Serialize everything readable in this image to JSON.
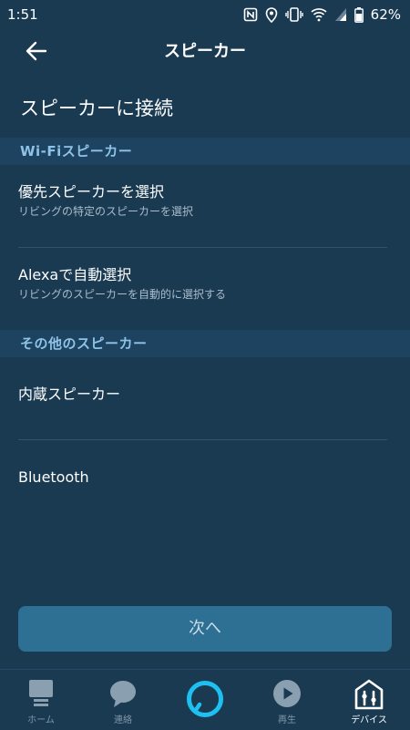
{
  "status_bar": {
    "time": "1:51",
    "battery": "62%",
    "icons": [
      "nfc-icon",
      "location-icon",
      "vibrate-icon",
      "wifi-icon",
      "signal-icon",
      "battery-icon"
    ]
  },
  "app_bar": {
    "title": "スピーカー",
    "back_icon": "arrow-left-icon"
  },
  "section_title": "スピーカーに接続",
  "groups": [
    {
      "header": "Wi-Fiスピーカー",
      "items": [
        {
          "title": "優先スピーカーを選択",
          "subtitle": "リビングの特定のスピーカーを選択"
        },
        {
          "title": "Alexaで自動選択",
          "subtitle": "リビングのスピーカーを自動的に選択する"
        }
      ]
    },
    {
      "header": "その他のスピーカー",
      "items": [
        {
          "title": "内蔵スピーカー"
        },
        {
          "title": "Bluetooth"
        }
      ]
    }
  ],
  "next_button": "次へ",
  "bottom_nav": [
    {
      "label": "ホーム",
      "icon": "home-icon"
    },
    {
      "label": "連絡",
      "icon": "chat-bubble-icon"
    },
    {
      "label": "",
      "icon": "alexa-ring-icon"
    },
    {
      "label": "再生",
      "icon": "play-icon"
    },
    {
      "label": "デバイス",
      "icon": "devices-icon",
      "active": true
    }
  ],
  "colors": {
    "background": "#1a3a52",
    "group_header_bg": "#1d4360",
    "group_header_text": "#8fc3e6",
    "button_bg": "#2e6f94",
    "alexa_ring": "#1ec0f2"
  }
}
